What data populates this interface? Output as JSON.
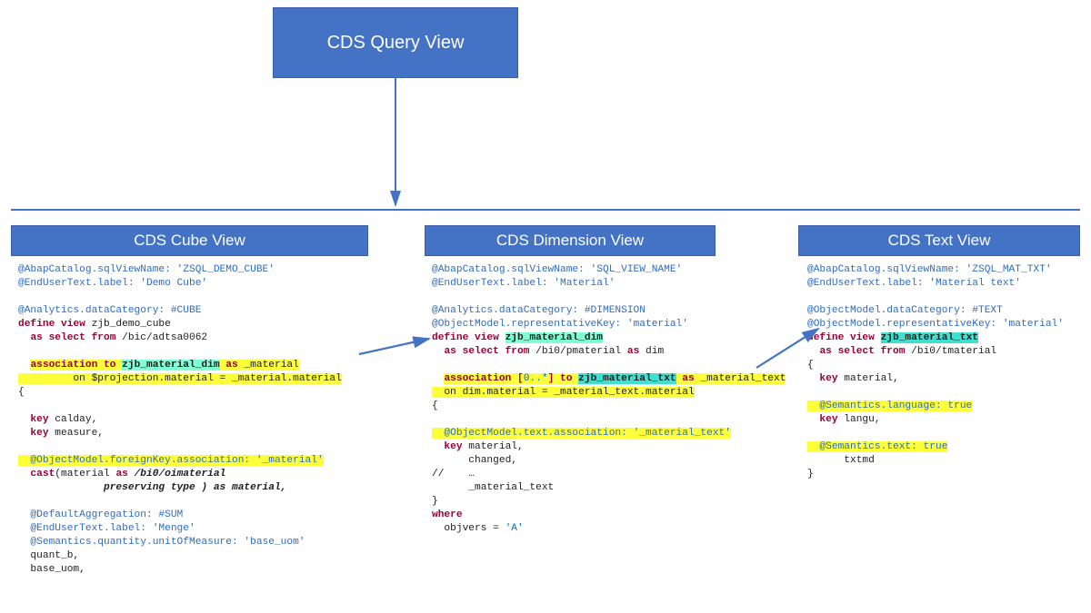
{
  "top": {
    "title": "CDS Query View"
  },
  "headers": {
    "cube": "CDS Cube View",
    "dim": "CDS Dimension View",
    "txt": "CDS Text View"
  },
  "cube": {
    "a1": "@AbapCatalog.sqlViewName: 'ZSQL_DEMO_CUBE'",
    "a2": "@EndUserText.label: 'Demo Cube'",
    "a3": "@Analytics.dataCategory: #CUBE",
    "kw_define": "define view",
    "viewname": " zjb_demo_cube",
    "kw_as_select": "as select from",
    "from": " /bic/adtsa0062",
    "assoc_prefix": "  ",
    "assoc_kw1": "association to ",
    "assoc_target": "zjb_material_dim",
    "assoc_kw2": " as ",
    "assoc_alias": "_material",
    "assoc_on": "         on $projection.material = _material.material",
    "brace_open": "{",
    "key1": "  key",
    "key1_name": " calday,",
    "key2": "  key",
    "key2_name": " measure,",
    "fk": "  @ObjectModel.foreignKey.association: '_material'",
    "cast_kw": "  cast",
    "cast_open": "(material ",
    "cast_as": "as",
    "cast_type": " /bi0/oimaterial",
    "cast_pres": "              preserving type ) as material,",
    "a_sum": "  @DefaultAggregation: #SUM",
    "a_menge": "  @EndUserText.label: 'Menge'",
    "a_uom": "  @Semantics.quantity.unitOfMeasure: 'base_uom'",
    "quant": "  quant_b,",
    "base": "  base_uom,"
  },
  "dim": {
    "a1": "@AbapCatalog.sqlViewName: 'SQL_VIEW_NAME'",
    "a2": "@EndUserText.label: 'Material'",
    "a3": "@Analytics.dataCategory: #DIMENSION",
    "a4": "@ObjectModel.representativeKey: 'material'",
    "kw_define": "define view ",
    "viewname": "zjb_material_dim",
    "sel_indent": "  ",
    "kw_as_select": "as select from",
    "from": " /bi0/pmaterial ",
    "as_dim": "as",
    "as_dim_name": " dim",
    "assoc_prefix": "  ",
    "assoc_kw": "association [",
    "assoc_card": "0..*",
    "assoc_kw2": "] to ",
    "assoc_target": "zjb_material_txt",
    "assoc_kw3": " as ",
    "assoc_alias": "_material_text",
    "assoc_on": "  on dim.material = _material_text.material",
    "brace_open": "{",
    "txtassoc": "  @ObjectModel.text.association: '_material_text'",
    "key_kw": "  key",
    "key_name": " material,",
    "changed": "      changed,",
    "comment": "//    …",
    "mtext": "      _material_text",
    "brace_close": "}",
    "where_kw": "where",
    "where_body": "  objvers = ",
    "where_lit": "'A'"
  },
  "txt": {
    "a1": "@AbapCatalog.sqlViewName: 'ZSQL_MAT_TXT'",
    "a2": "@EndUserText.label: 'Material text'",
    "a3": "@ObjectModel.dataCategory: #TEXT",
    "a4": "@ObjectModel.representativeKey: 'material'",
    "kw_define": "define view ",
    "viewname": "zjb_material_txt",
    "sel_indent": "  ",
    "kw_as_select": "as select from",
    "from": " /bi0/tmaterial",
    "brace_open": "{",
    "key_kw": "  key",
    "key_name": " material,",
    "semlang": "  @Semantics.language: true",
    "key2_kw": "  key",
    "key2_name": " langu,",
    "semtxt": "  @Semantics.text: true",
    "txtmd": "      txtmd",
    "brace_close": "}"
  }
}
